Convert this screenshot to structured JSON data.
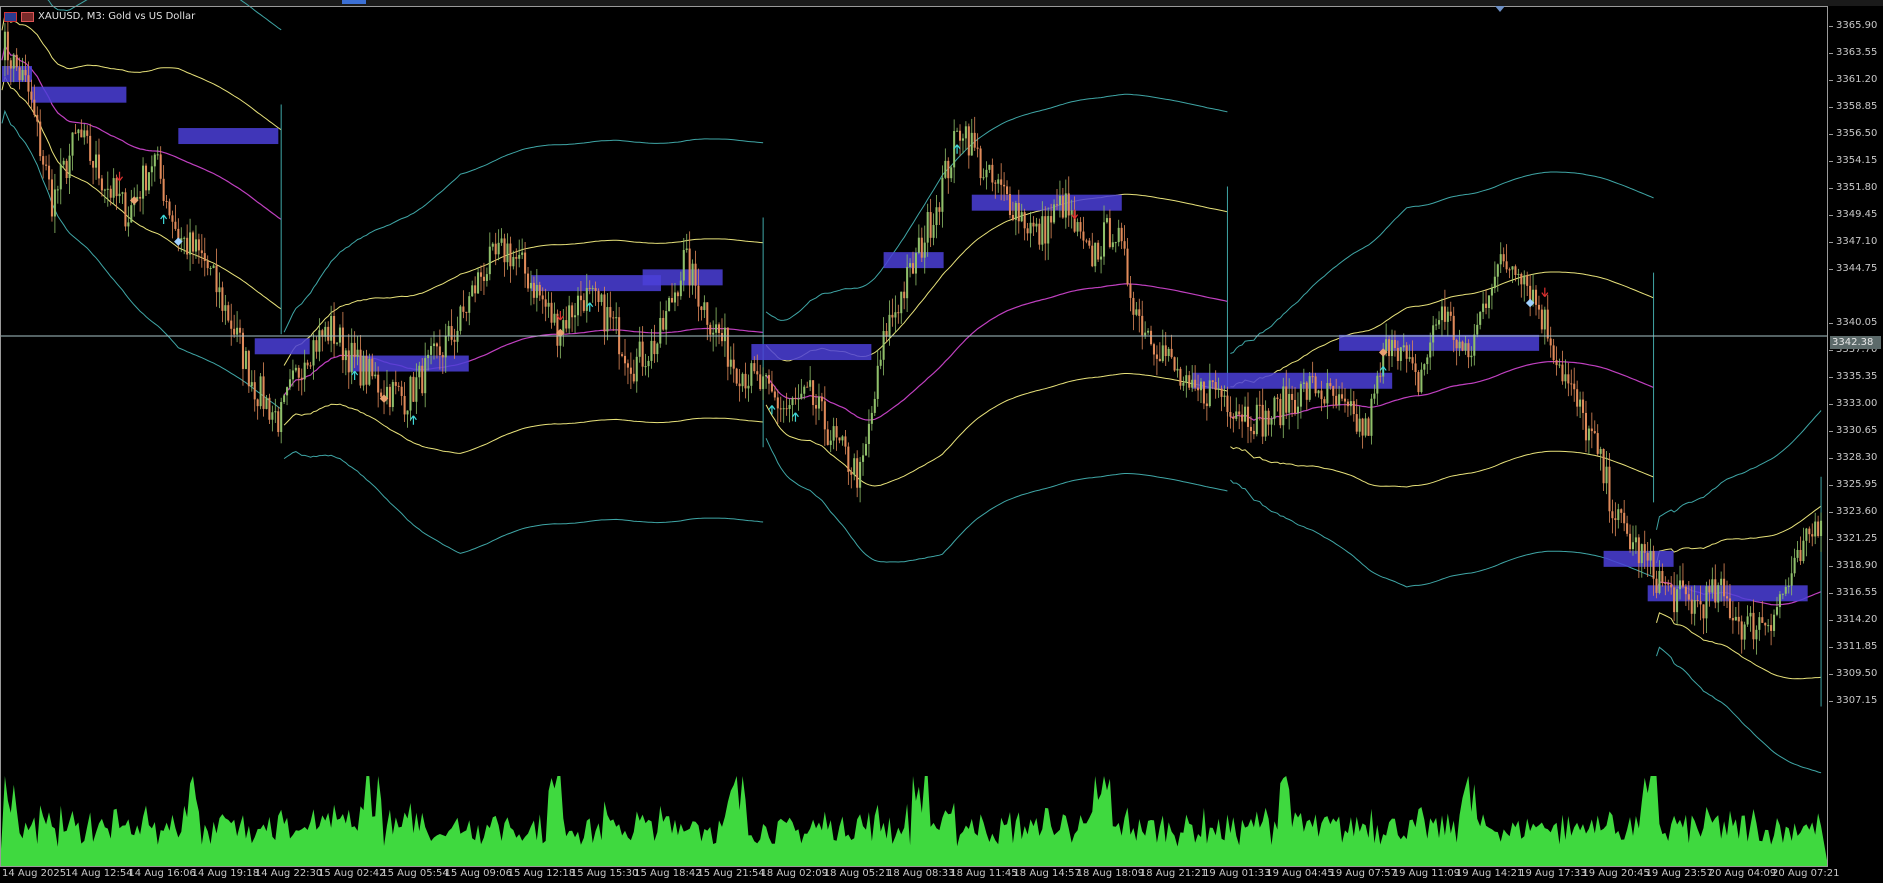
{
  "window": {
    "symbol_title": "XAUUSD, M3:  Gold vs US Dollar",
    "current_price": "3342.38"
  },
  "colors": {
    "background": "#000000",
    "grid_border": "#9a9a9a",
    "axis_text": "#c8c8c8",
    "candle_bull": "#8fbf6a",
    "candle_bear": "#e08a5a",
    "volume": "#3fd93f",
    "volume_profile": "#4b3fd8",
    "vwap_band": "#3fa6a6",
    "vwap_mid": "#e8e27a",
    "vwap_mean": "#c040c0",
    "crosshair": "#a8c4c8",
    "arrow_up": "#3fd9d9",
    "arrow_down": "#e03030"
  },
  "price_axis": {
    "labels": [
      "3365.90",
      "3363.55",
      "3361.20",
      "3358.85",
      "3356.50",
      "3354.15",
      "3351.80",
      "3349.45",
      "3347.10",
      "3344.75",
      "3340.05",
      "3337.70",
      "3335.35",
      "3333.00",
      "3330.65",
      "3328.30",
      "3325.95",
      "3323.60",
      "3321.25",
      "3318.90",
      "3316.55",
      "3314.20",
      "3311.85",
      "3309.50",
      "3307.15"
    ]
  },
  "time_axis": {
    "labels": [
      "14 Aug 2025",
      "14 Aug 12:54",
      "14 Aug 16:06",
      "14 Aug 19:18",
      "14 Aug 22:30",
      "15 Aug 02:42",
      "15 Aug 05:54",
      "15 Aug 09:06",
      "15 Aug 12:18",
      "15 Aug 15:30",
      "15 Aug 18:42",
      "15 Aug 21:54",
      "18 Aug 02:09",
      "18 Aug 05:21",
      "18 Aug 08:33",
      "18 Aug 11:45",
      "18 Aug 14:57",
      "18 Aug 18:09",
      "18 Aug 21:21",
      "19 Aug 01:33",
      "19 Aug 04:45",
      "19 Aug 07:57",
      "19 Aug 11:09",
      "19 Aug 14:21",
      "19 Aug 17:33",
      "19 Aug 20:45",
      "19 Aug 23:57",
      "20 Aug 04:09",
      "20 Aug 07:21"
    ]
  },
  "price_path": [
    3364,
    3360,
    3350,
    3356,
    3352,
    3349,
    3354,
    3347,
    3345,
    3340,
    3334,
    3331,
    3337,
    3339,
    3336,
    3334,
    3333,
    3336,
    3339,
    3344,
    3346,
    3343,
    3339,
    3342,
    3340,
    3336,
    3338,
    3345,
    3340,
    3336,
    3334,
    3332,
    3333,
    3329,
    3326,
    3339,
    3344,
    3350,
    3357,
    3352,
    3350,
    3347,
    3350,
    3345,
    3348,
    3340,
    3337,
    3333,
    3334,
    3332,
    3331,
    3333,
    3334,
    3332,
    3330,
    3339,
    3334,
    3341,
    3336,
    3344,
    3345,
    3340,
    3334,
    3329,
    3322,
    3319,
    3316,
    3315,
    3316,
    3313,
    3314,
    3318,
    3323
  ]
}
